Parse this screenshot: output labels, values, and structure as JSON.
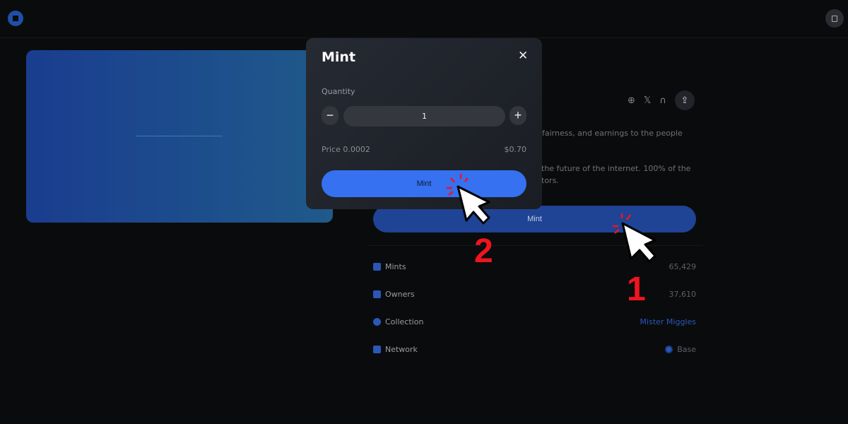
{
  "header": {
    "logo_icon": "app-logo-icon",
    "wallet_icon": "wallet-icon"
  },
  "social": {
    "icons": [
      "globe-icon",
      "x-icon",
      "opensea-arch-icon",
      "share-icon"
    ],
    "globe": "⊕",
    "x": "𝕏",
    "arch": "∩",
    "share": "⇪"
  },
  "description": {
    "line1": ", fairness, and earnings to the people",
    "line2": " the future of the internet. 100% of the",
    "line3": "tors."
  },
  "main_mint_label": "Mint",
  "stats": [
    {
      "label": "Mints",
      "value": "65,429",
      "icon": "shield-star-icon"
    },
    {
      "label": "Owners",
      "value": "37,610",
      "icon": "people-icon"
    },
    {
      "label": "Collection",
      "value": "Mister Miggles",
      "icon": "collection-icon"
    },
    {
      "label": "Network",
      "value": "Base",
      "icon": "network-icon"
    }
  ],
  "modal": {
    "title": "Mint",
    "close": "✕",
    "quantity_label": "Quantity",
    "minus": "−",
    "plus": "+",
    "quantity": "1",
    "price": "Price 0.0002",
    "usd": "$0.70",
    "mint_label": "Mint"
  },
  "annotations": {
    "step1": "1",
    "step2": "2",
    "color": "#f0141e"
  },
  "colors": {
    "accent": "#3571f0",
    "background": "#0a0b0d"
  }
}
